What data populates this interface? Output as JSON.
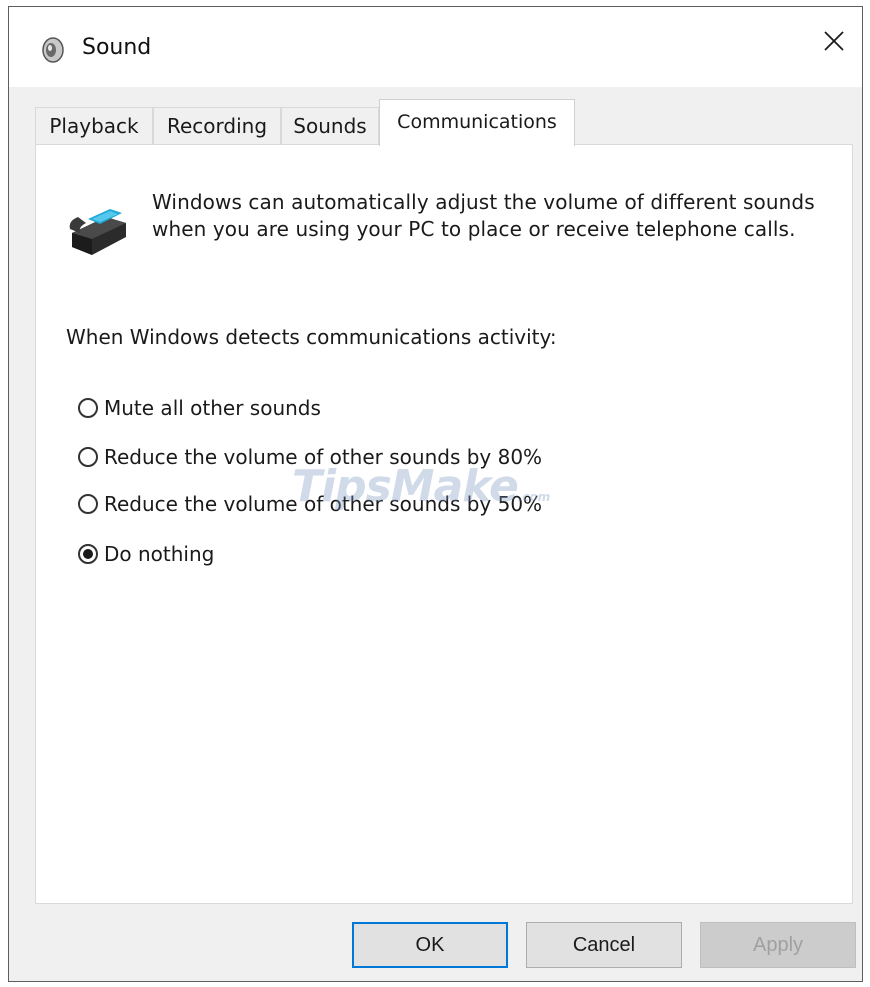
{
  "window": {
    "title": "Sound",
    "icon": "speaker-icon",
    "close_icon": "close-icon"
  },
  "tabs": [
    {
      "label": "Playback",
      "active": false
    },
    {
      "label": "Recording",
      "active": false
    },
    {
      "label": "Sounds",
      "active": false
    },
    {
      "label": "Communications",
      "active": true
    }
  ],
  "communications": {
    "icon": "telephone-icon",
    "description": "Windows can automatically adjust the volume of different sounds when you are using your PC to place or receive telephone calls.",
    "section_label": "When Windows detects communications activity:",
    "options": [
      {
        "label": "Mute all other sounds",
        "checked": false
      },
      {
        "label": "Reduce the volume of other sounds by 80%",
        "checked": false
      },
      {
        "label": "Reduce the volume of other sounds by 50%",
        "checked": false
      },
      {
        "label": "Do nothing",
        "checked": true
      }
    ]
  },
  "watermark": {
    "text": "TipsMake",
    "suffix": ".com"
  },
  "buttons": {
    "ok": "OK",
    "cancel": "Cancel",
    "apply": "Apply"
  },
  "colors": {
    "accent": "#0078d7",
    "window_bg": "#f0f0f0",
    "panel_bg": "#ffffff"
  }
}
